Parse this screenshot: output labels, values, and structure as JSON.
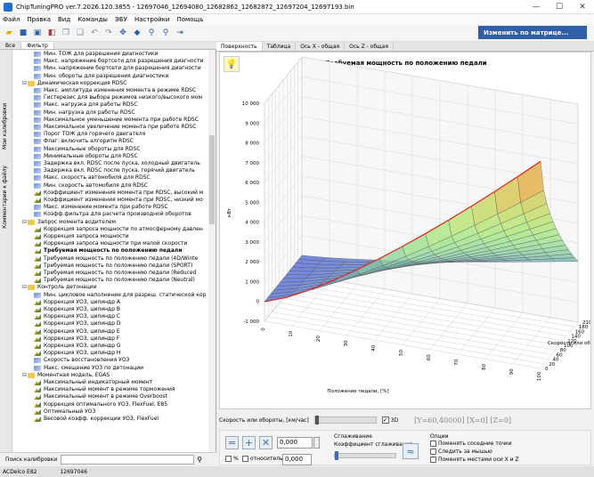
{
  "window": {
    "title": "ChipTuningPRO ver.7.2026.120.3855 - 12697046_12694080_12682862_12682872_12697204_12697193.bin",
    "minimize": "—",
    "maximize": "☐",
    "close": "✕"
  },
  "menu": [
    "Файл",
    "Правка",
    "Вид",
    "Команды",
    "ЭБУ",
    "Настройки",
    "Помощь"
  ],
  "right_toolbar": {
    "change_matrix": "Изменить по матрице..."
  },
  "left_tabs": [
    "Все",
    "Фильтр"
  ],
  "vertical_tabs": [
    "Мои калибровки",
    "Комментарии к файлу"
  ],
  "tree": [
    {
      "level": 2,
      "icon": "map",
      "label": "Мин. ТОЖ для разрешения диагностики"
    },
    {
      "level": 2,
      "icon": "map",
      "label": "Макс. напряжение бортсети для разрешения диагности"
    },
    {
      "level": 2,
      "icon": "map",
      "label": "Мин. напряжение бортсети для разрешения диагности"
    },
    {
      "level": 2,
      "icon": "map",
      "label": "Мин. обороты для разрешения диагностики"
    },
    {
      "level": 1,
      "icon": "folder",
      "label": "Динамическая коррекция RDSC",
      "expanded": true
    },
    {
      "level": 2,
      "icon": "map",
      "label": "Макс. амплитуда изменения момента в режиме RDSC"
    },
    {
      "level": 2,
      "icon": "map",
      "label": "Гистерезис для выбора режимов низкого/высокого мом"
    },
    {
      "level": 2,
      "icon": "map",
      "label": "Макс. нагрузка для работы RDSC"
    },
    {
      "level": 2,
      "icon": "map",
      "label": "Мин. нагрузка для работы RDSC"
    },
    {
      "level": 2,
      "icon": "map",
      "label": "Максимальное уменьшение момента при работе RDSC"
    },
    {
      "level": 2,
      "icon": "map",
      "label": "Максимальное увеличение момента при работе RDSC"
    },
    {
      "level": 2,
      "icon": "map",
      "label": "Порог ТОЖ для горячего двигателя"
    },
    {
      "level": 2,
      "icon": "map",
      "label": "Флаг: включить алгоритм RDSC"
    },
    {
      "level": 2,
      "icon": "map",
      "label": "Максимальные обороты для RDSC"
    },
    {
      "level": 2,
      "icon": "map",
      "label": "Минимальные обороты для RDSC"
    },
    {
      "level": 2,
      "icon": "map",
      "label": "Задержка вкл. RDSC после пуска, холодный двигатель"
    },
    {
      "level": 2,
      "icon": "map",
      "label": "Задержка вкл. RDSC после пуска, горячий двигатель"
    },
    {
      "level": 2,
      "icon": "map",
      "label": "Макс. скорость автомобиля для RDSC"
    },
    {
      "level": 2,
      "icon": "map",
      "label": "Мин. скорость автомобиля для RDSC"
    },
    {
      "level": 2,
      "icon": "surf",
      "label": "Коэффициент изменения момента при RDSC, высокий м"
    },
    {
      "level": 2,
      "icon": "surf",
      "label": "Коэффициент изменения момента при RDSC, низкий мо"
    },
    {
      "level": 2,
      "icon": "map",
      "label": "Макс. изменение момента при работе RDSC"
    },
    {
      "level": 2,
      "icon": "map",
      "label": "Коэфф.фильтра для расчета производной оборотов"
    },
    {
      "level": 1,
      "icon": "folder",
      "label": "Запрос момента водителем",
      "expanded": true
    },
    {
      "level": 2,
      "icon": "surf",
      "label": "Коррекция запроса мощности по атмосферному давлен"
    },
    {
      "level": 2,
      "icon": "surf",
      "label": "Коррекция запроса мощности"
    },
    {
      "level": 2,
      "icon": "surf",
      "label": "Коррекция запроса мощности при малой скорости"
    },
    {
      "level": 2,
      "icon": "surf",
      "label": "Требуемая мощность по положению педали",
      "selected": true
    },
    {
      "level": 2,
      "icon": "surf",
      "label": "Требуемая мощность по положению педали (4D/Winte"
    },
    {
      "level": 2,
      "icon": "surf",
      "label": "Требуемая мощность по положению педали (SPORT)"
    },
    {
      "level": 2,
      "icon": "surf",
      "label": "Требуемая мощность по положению педали (Reduced"
    },
    {
      "level": 2,
      "icon": "surf",
      "label": "Требуемая мощность по положению педали (Neutral)"
    },
    {
      "level": 1,
      "icon": "folder",
      "label": "Контроль детонации",
      "expanded": true
    },
    {
      "level": 2,
      "icon": "map",
      "label": "Мин. цикловое наполнение для разреш. статической кор"
    },
    {
      "level": 2,
      "icon": "surf",
      "label": "Коррекция УОЗ, цилиндр A"
    },
    {
      "level": 2,
      "icon": "surf",
      "label": "Коррекция УОЗ, цилиндр B"
    },
    {
      "level": 2,
      "icon": "surf",
      "label": "Коррекция УОЗ, цилиндр C"
    },
    {
      "level": 2,
      "icon": "surf",
      "label": "Коррекция УОЗ, цилиндр D"
    },
    {
      "level": 2,
      "icon": "surf",
      "label": "Коррекция УОЗ, цилиндр E"
    },
    {
      "level": 2,
      "icon": "surf",
      "label": "Коррекция УОЗ, цилиндр F"
    },
    {
      "level": 2,
      "icon": "surf",
      "label": "Коррекция УОЗ, цилиндр G"
    },
    {
      "level": 2,
      "icon": "surf",
      "label": "Коррекция УОЗ, цилиндр H"
    },
    {
      "level": 2,
      "icon": "map",
      "label": "Скорость восстановления УОЗ"
    },
    {
      "level": 2,
      "icon": "map",
      "label": "Макс. смещение УОЗ по детонации"
    },
    {
      "level": 1,
      "icon": "folder",
      "label": "Моментная модель, EGAS",
      "expanded": true
    },
    {
      "level": 2,
      "icon": "surf",
      "label": "Максимальный индикаторный момент"
    },
    {
      "level": 2,
      "icon": "surf",
      "label": "Максимальный момент в режиме торможения"
    },
    {
      "level": 2,
      "icon": "surf",
      "label": "Максимальный момент в режиме Overboost"
    },
    {
      "level": 2,
      "icon": "surf",
      "label": "Коррекция оптимального УОЗ, FlexFuel, E85"
    },
    {
      "level": 2,
      "icon": "surf",
      "label": "Оптимальный УОЗ"
    },
    {
      "level": 2,
      "icon": "surf",
      "label": "Весовой коэфф. коррекции УОЗ, FlexFuel"
    }
  ],
  "search": {
    "label": "Поиск калибровки",
    "value": ""
  },
  "status": [
    "ACDelco E82",
    "12697046"
  ],
  "right_tabs": [
    "Поверхность",
    "Таблица",
    "Ось X - общая",
    "Ось Z - общая"
  ],
  "plot": {
    "title": "Требуемая мощность по положению педали",
    "zlabel": "кВт",
    "xlabel": "Положение педали, [%]",
    "ylabel": "Скорость или обороты",
    "z_ticks": [
      "10 000",
      "9 000",
      "8 000",
      "7 000",
      "6 000",
      "5 000",
      "4 000",
      "3 000",
      "2 000",
      "1 000",
      "0",
      "-1 000"
    ],
    "x_ticks": [
      "0",
      "10",
      "20",
      "30",
      "40",
      "50",
      "60",
      "70",
      "80",
      "90",
      "100"
    ],
    "y_ticks": [
      "0",
      "20",
      "40",
      "60",
      "80",
      "100",
      "120",
      "140",
      "160",
      "180",
      "210"
    ]
  },
  "speed_bar": {
    "label": "Скорость или обороты, [км/час]",
    "checkbox": "3D",
    "info": "[Y=60,40000] [X=0] [Z=0]"
  },
  "bottom": {
    "value1": "0,000",
    "value2": "0,000",
    "percent": "%",
    "relative": "относительно",
    "smoothing_title": "Сглаживание",
    "smoothing_coef": "Коэффициент сглаживания",
    "options_title": "Опции",
    "opt1": "Поменять соседние точки",
    "opt2": "Следить за мышью",
    "opt3": "Поменять местами оси X и Z"
  },
  "colors": {
    "accent": "#2e5fa8",
    "surface_high": "#f0a040",
    "surface_low": "#5a6ad0",
    "edge": "#e02020"
  }
}
